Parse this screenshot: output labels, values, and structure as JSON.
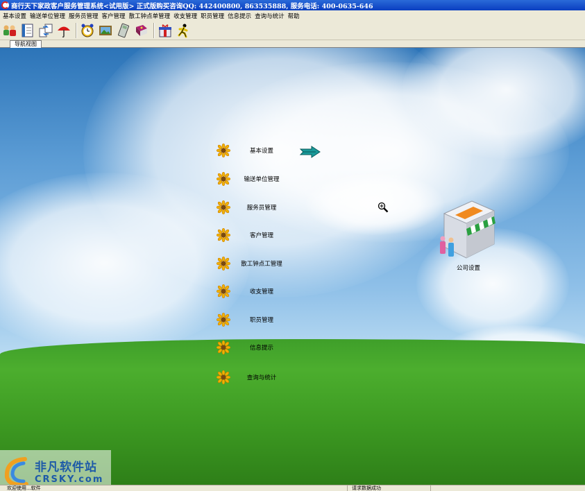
{
  "window": {
    "title": "商行天下家政客户服务管理系统<试用版> 正式版购买咨询QQ: 442400800, 863535888, 服务电话: 400-0635-646"
  },
  "menu": [
    "基本设置",
    "输送单位管理",
    "服务员管理",
    "客户管理",
    "散工钟点单管理",
    "收支管理",
    "职员管理",
    "信息提示",
    "查询与统计",
    "帮助"
  ],
  "toolbar": {
    "buttons": [
      "users-icon",
      "notebook-icon",
      "transfer-icon",
      "umbrella-icon",
      "alarm-clock-icon",
      "picture-icon",
      "calculator-icon",
      "book-icon",
      "gift-icon",
      "runner-icon"
    ]
  },
  "tabs": {
    "active": "导航视图"
  },
  "nav": {
    "items": [
      "基本设置",
      "输送单位管理",
      "服务员管理",
      "客户管理",
      "散工钟点工管理",
      "收支管理",
      "职员管理",
      "信息提示",
      "查询与统计"
    ],
    "company_label": "公司设置"
  },
  "watermark": {
    "cn": "非凡软件站",
    "en": "CRSKY.com"
  },
  "statusbar": {
    "left": "欢迎使用...软件",
    "right": "请求数据成功"
  },
  "colors": {
    "title_bar": "#0a3ec0",
    "sky": "#5a9bd4",
    "grass": "#4cae2e"
  }
}
